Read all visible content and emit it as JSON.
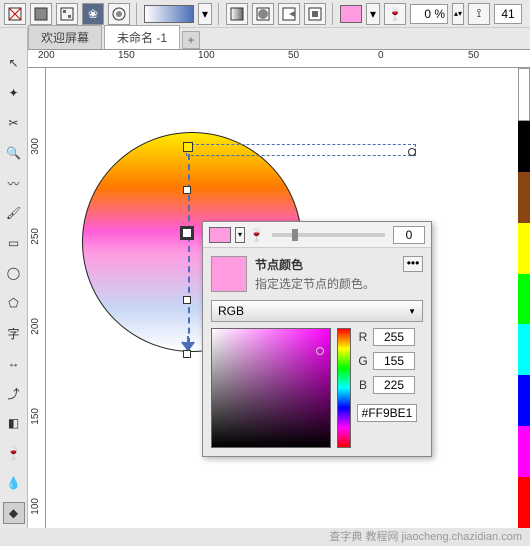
{
  "topbar": {
    "transparency_label": "0 %",
    "last_value": "41"
  },
  "tabs": {
    "welcome": "欢迎屏幕",
    "doc": "未命名 -1"
  },
  "hruler": [
    "200",
    "150",
    "100",
    "50",
    "0",
    "50"
  ],
  "vruler": [
    "300",
    "250",
    "200",
    "150",
    "100"
  ],
  "node_panel": {
    "pct": "0",
    "title": "节点颜色",
    "desc": "指定选定节点的颜色。",
    "mode": "RGB",
    "r_label": "R",
    "r_val": "255",
    "g_label": "G",
    "g_val": "155",
    "b_label": "B",
    "b_val": "225",
    "hex": "#FF9BE1"
  },
  "footer": "查字典  教程网  jiaocheng.chazidian.com"
}
